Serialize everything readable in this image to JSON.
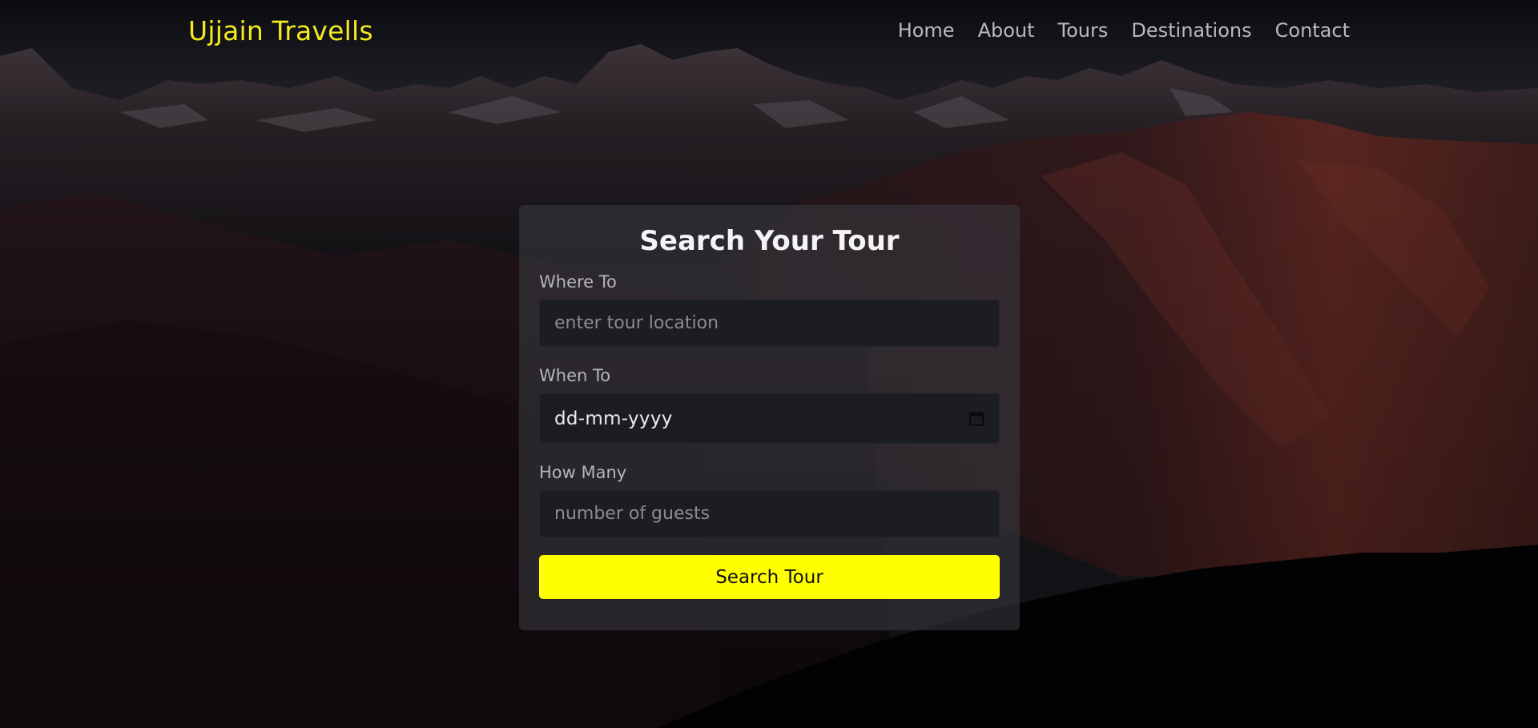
{
  "brand": {
    "name": "Ujjain Travells",
    "color": "#f3ea20"
  },
  "nav": {
    "items": [
      "Home",
      "About",
      "Tours",
      "Destinations",
      "Contact"
    ]
  },
  "search_form": {
    "title": "Search Your Tour",
    "where": {
      "label": "Where To",
      "placeholder": "enter tour location",
      "value": ""
    },
    "when": {
      "label": "When To",
      "value": "dd-mm-yyyy",
      "icon": "calendar-icon"
    },
    "guests": {
      "label": "How Many",
      "placeholder": "number of guests",
      "value": ""
    },
    "submit_label": "Search Tour",
    "accent_color": "#ffff00"
  }
}
